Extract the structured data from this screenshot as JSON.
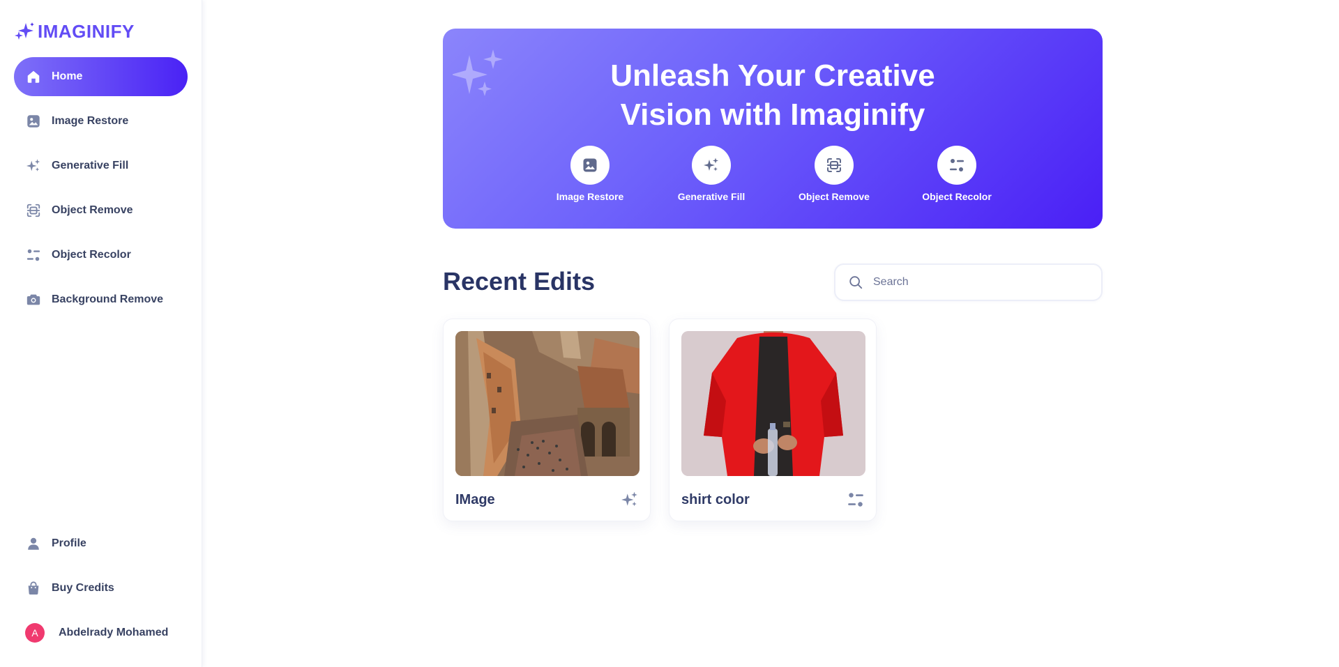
{
  "brand": {
    "name": "IMAGINIFY",
    "primary_color": "#624cf5",
    "gradient_from": "#8b85fb",
    "gradient_to": "#4a1ff6"
  },
  "sidebar": {
    "items": [
      {
        "label": "Home",
        "icon": "home-icon",
        "active": true
      },
      {
        "label": "Image Restore",
        "icon": "image-icon"
      },
      {
        "label": "Generative Fill",
        "icon": "stars-icon"
      },
      {
        "label": "Object Remove",
        "icon": "scan-icon"
      },
      {
        "label": "Object Recolor",
        "icon": "filter-icon"
      },
      {
        "label": "Background Remove",
        "icon": "camera-icon"
      }
    ],
    "bottom_items": [
      {
        "label": "Profile",
        "icon": "user-icon"
      },
      {
        "label": "Buy Credits",
        "icon": "bag-icon"
      }
    ],
    "user": {
      "initial": "A",
      "name": "Abdelrady Mohamed",
      "avatar_color": "#f03a6f"
    }
  },
  "banner": {
    "title": "Unleash Your Creative\nVision with Imaginify",
    "links": [
      {
        "label": "Image Restore",
        "icon": "image-icon"
      },
      {
        "label": "Generative Fill",
        "icon": "stars-icon"
      },
      {
        "label": "Object Remove",
        "icon": "scan-icon"
      },
      {
        "label": "Object Recolor",
        "icon": "filter-icon"
      }
    ]
  },
  "recent": {
    "title": "Recent Edits",
    "search_placeholder": "Search",
    "search_value": "",
    "cards": [
      {
        "title": "IMage",
        "type_icon": "stars-icon",
        "thumbnail": "aerial-town-square-photo"
      },
      {
        "title": "shirt color",
        "type_icon": "filter-icon",
        "thumbnail": "man-red-shirt-photo"
      }
    ]
  }
}
